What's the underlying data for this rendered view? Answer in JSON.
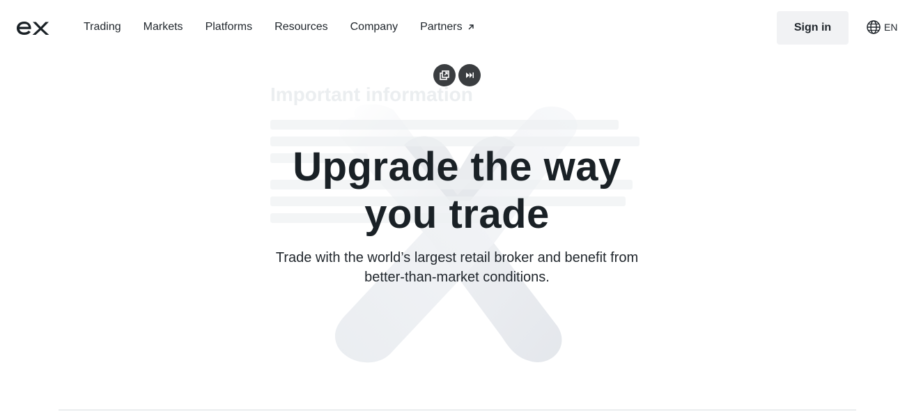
{
  "header": {
    "logo_alt": "ex",
    "nav": [
      {
        "label": "Trading"
      },
      {
        "label": "Markets"
      },
      {
        "label": "Platforms"
      },
      {
        "label": "Resources"
      },
      {
        "label": "Company"
      },
      {
        "label": "Partners"
      }
    ],
    "signin_label": "Sign in",
    "language": "EN"
  },
  "hero": {
    "ghost_title": "Important information",
    "headline_line1": "Upgrade the way",
    "headline_line2": "you trade",
    "subline_line1": "Trade with the world’s largest retail broker and benefit from",
    "subline_line2": "better-than-market conditions."
  },
  "media_controls": {
    "icons": [
      "popout-icon",
      "skip-forward-icon"
    ]
  },
  "colors": {
    "text": "#1f252b",
    "signin_bg": "#f1f2f4",
    "media_btn_bg": "#3a3d40"
  }
}
